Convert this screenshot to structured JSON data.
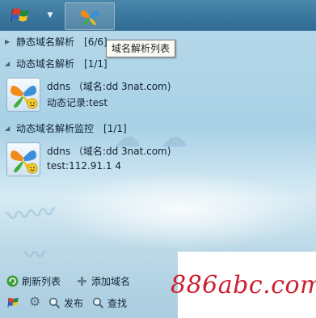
{
  "tooltip": "域名解析列表",
  "groups": [
    {
      "label": "静态域名解析",
      "count": "[6/6]",
      "expanded": false
    },
    {
      "label": "动态域名解析",
      "count": "[1/1]",
      "expanded": true
    },
    {
      "label": "动态域名解析监控",
      "count": "[1/1]",
      "expanded": true
    }
  ],
  "contacts": [
    {
      "name": "ddns  （域名:dd         3nat.com)",
      "status": "动态记录:test"
    },
    {
      "name": "ddns  （域名:dd         3nat.com)",
      "status": "test:112.91.1         4"
    }
  ],
  "bottom": {
    "refresh": "刷新列表",
    "add_domain": "添加域名",
    "publish": "发布",
    "find": "查找"
  },
  "watermark": "886abc.com",
  "colors": {
    "topbar": "#2e6a92",
    "background": "#a9d1e6",
    "watermark_text": "#cc1f2e"
  }
}
